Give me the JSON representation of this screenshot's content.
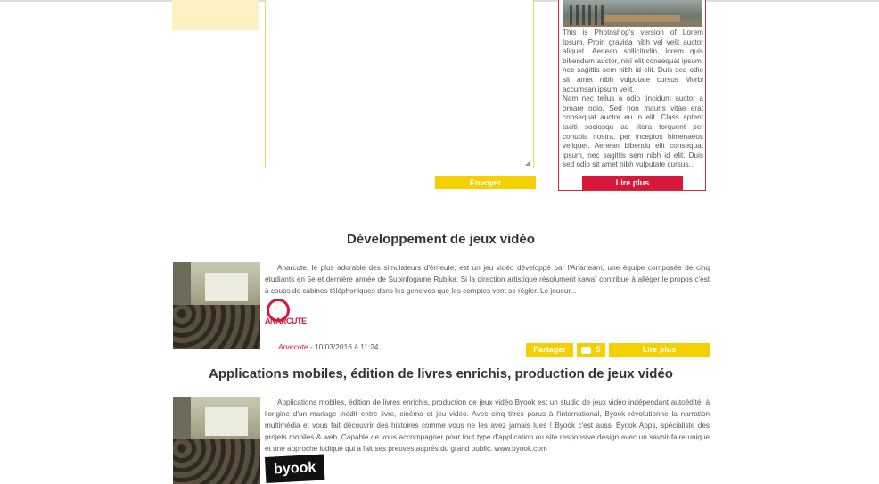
{
  "form": {
    "send_label": "Envoyer"
  },
  "card": {
    "paragraph1": "This is Photoshop's version of Lorem Ipsum. Proin gravida nibh vel velit auctor aliquet. Aenean sollicitudin, lorem quis bibendum auctor, nisi elit consequat ipsum, nec sagittis sem nibh id elit. Duis sed odio sit amet nibh vulputate cursus Morbi accumsan ipsum velit.",
    "paragraph2": "Nam nec tellus a odio tincidunt auctor a ornare odio. Sed non mauris vitae erat consequat auctor eu in elit. Class aptent taciti sociosqu ad litora torquent per conubia nostra, per inceptos himenaeos veliquet. Aenean bibendu elit consequat ipsum, nec sagittis sem nibh id elit. Duis sed odio sit amet nibh vulputate cursus...",
    "readmore_label": "Lire plus"
  },
  "articles": [
    {
      "title": "Développement de jeux vidéo",
      "body": "Anarcute, le plus adorable des simulateurs d'émeute, est un jeu vidéo développé par l'Anarteam, une équipe composée de cinq étudiants en 5e et dernière année de Supinfogame Rubika. Si la direction artistique résolument kawaï contribue à alléger le propos c'est à coups de cabines téléphoniques dans les gencives que les comptes vont se régler. Le joueur...",
      "logo_text": "ANARCUTE",
      "author": "Anarcute",
      "date": "- 10/03/2016 à 11:24",
      "share_label": "Partager",
      "comments_count": "5",
      "readmore_label": "Lire plus"
    },
    {
      "title": "Applications mobiles, édition de livres enrichis, production de jeux vidéo",
      "body": "Applications mobiles, édition de livres enrichis, production de jeux vidéo Byook est un studio de jeux vidéo indépendant autoédité, à l'origine d'un mariage inédit entre livre, cinéma et jeu vidéo. Avec cinq titres parus à l'international, Byook révolutionne la narration multimédia et vous fait découvrir des histoires comme vous ne les avez jamais lues ! Byook c'est aussi Byook Apps, spécialiste des projets mobiles & web. Capable de vous accompagner pour tout type d'application ou site responsive design avec un savoir-faire unique et une approche ludique qui a fait ses preuves auprès du grand public. www.byook.com",
      "logo_text": "byook"
    }
  ],
  "colors": {
    "accent_yellow": "#f5d000",
    "accent_red": "#d6183a"
  }
}
